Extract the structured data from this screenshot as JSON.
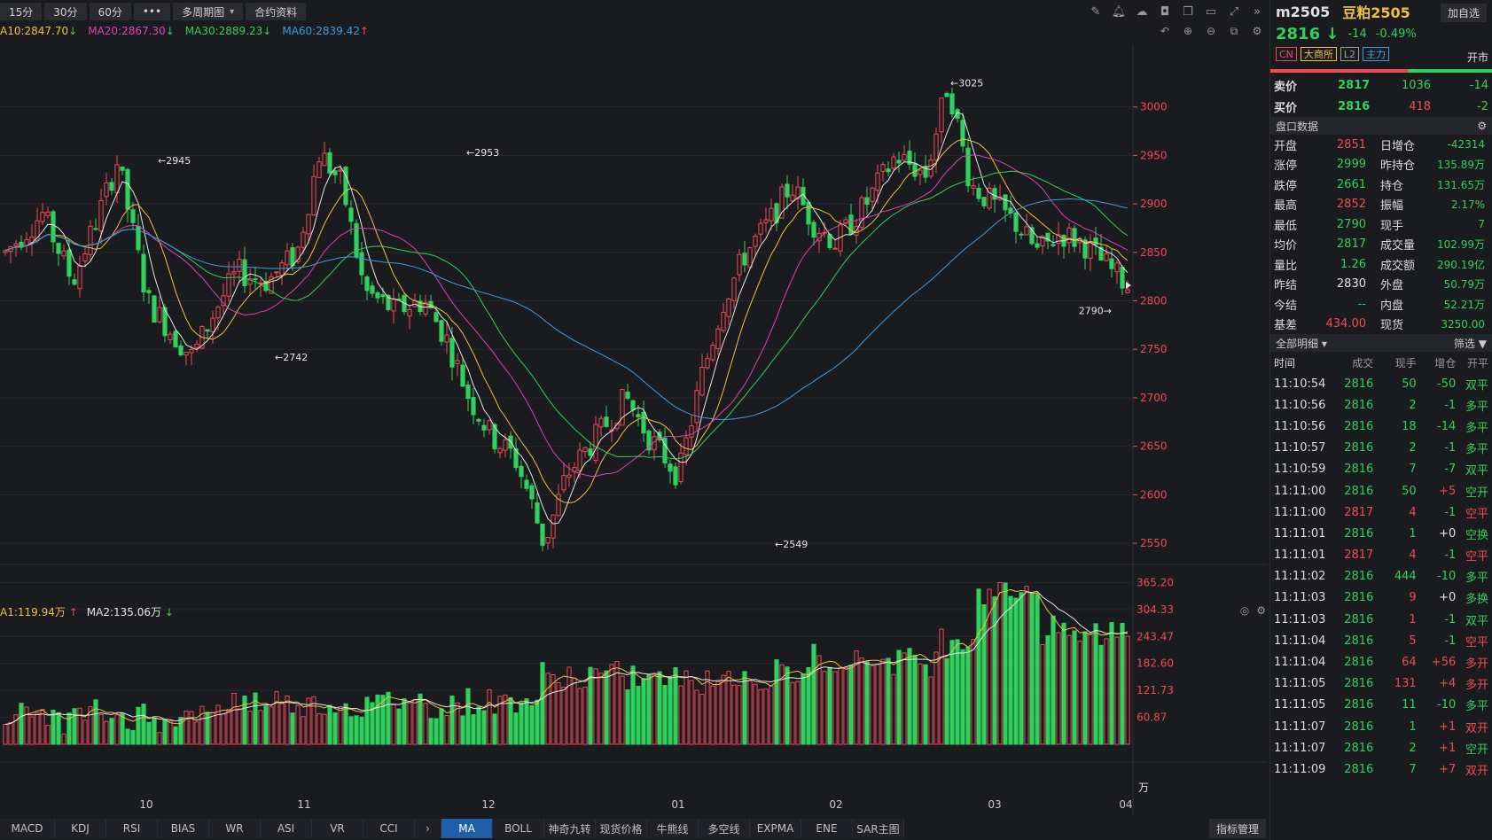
{
  "toolbar": {
    "buttons": [
      "15分",
      "30分",
      "60分",
      "•••",
      "多周期图",
      "合约资料"
    ],
    "icons": [
      "pencil-icon",
      "bell-icon",
      "cloud-icon",
      "camera-icon",
      "copy-icon",
      "monitor-icon",
      "fullscreen-icon",
      "collapse-icon"
    ]
  },
  "ma_legend": [
    {
      "text": "A10:2847.70",
      "color": "#f0c040",
      "arrow": "↓",
      "arrow_color": "#2fd15c"
    },
    {
      "text": "MA20:2867.30",
      "color": "#e040b0",
      "arrow": "↓",
      "arrow_color": "#2fd15c"
    },
    {
      "text": "MA30:2889.23",
      "color": "#2fd15c",
      "arrow": "↓",
      "arrow_color": "#2fd15c"
    },
    {
      "text": "MA60:2839.42",
      "color": "#3a9ee0",
      "arrow": "↑",
      "arrow_color": "#f24957"
    }
  ],
  "vol_legend": [
    {
      "text": "A1:119.94万",
      "color": "#f0c040",
      "arrow": "↑",
      "arrow_color": "#f24957"
    },
    {
      "text": "MA2:135.06万",
      "color": "#e6e6e6",
      "arrow": "↓",
      "arrow_color": "#2fd15c"
    }
  ],
  "chart_data": {
    "type": "candlestick",
    "price_axis": {
      "ticks": [
        3000,
        2950,
        2900,
        2850,
        2800,
        2750,
        2700,
        2650,
        2600,
        2550
      ],
      "range": [
        2530,
        3060
      ]
    },
    "volume_axis": {
      "ticks": [
        "365.20",
        "304.33",
        "243.47",
        "182.60",
        "121.73",
        "60.87"
      ],
      "unit": "万",
      "range": [
        0,
        380
      ]
    },
    "x_labels": [
      "10",
      "11",
      "12",
      "01",
      "02",
      "03",
      "04"
    ],
    "annotations": [
      "2945",
      "2953",
      "2742",
      "2549",
      "3025",
      "2790"
    ],
    "current_marker": "2816"
  },
  "indicator_tabs": [
    "MACD",
    "KDJ",
    "RSI",
    "BIAS",
    "WR",
    "ASI",
    "VR",
    "CCI",
    "›",
    "MA",
    "BOLL",
    "神奇九转",
    "现货价格",
    "牛熊线",
    "多空线",
    "EXPMA",
    "ENE",
    "SAR主图"
  ],
  "active_indicator": "MA",
  "indicator_manage": "指标管理",
  "panel": {
    "code": "m2505",
    "name": "豆粕2505",
    "add_fav": "加自选",
    "price": "2816",
    "change": "-14",
    "change_pct": "-0.49%",
    "tags": [
      "CN",
      "大商所",
      "L2",
      "主力"
    ],
    "open_status": "开市",
    "orderbook": [
      {
        "label": "卖价",
        "price": "2817",
        "vol": "1036",
        "chg": "-14"
      },
      {
        "label": "买价",
        "price": "2816",
        "vol": "418",
        "chg": "-2"
      }
    ],
    "stats_title": "盘口数据",
    "stats": [
      {
        "k1": "开盘",
        "v1": "2851",
        "c1": "red",
        "k2": "日增仓",
        "v2": "-42314",
        "c2": "green"
      },
      {
        "k1": "涨停",
        "v1": "2999",
        "c1": "green",
        "k2": "昨持仓",
        "v2": "135.89万",
        "c2": "green"
      },
      {
        "k1": "跌停",
        "v1": "2661",
        "c1": "green",
        "k2": "持仓",
        "v2": "131.65万",
        "c2": "green"
      },
      {
        "k1": "最高",
        "v1": "2852",
        "c1": "red",
        "k2": "振幅",
        "v2": "2.17%",
        "c2": "green"
      },
      {
        "k1": "最低",
        "v1": "2790",
        "c1": "green",
        "k2": "现手",
        "v2": "7",
        "c2": "green"
      },
      {
        "k1": "均价",
        "v1": "2817",
        "c1": "green",
        "k2": "成交量",
        "v2": "102.99万",
        "c2": "green"
      },
      {
        "k1": "量比",
        "v1": "1.26",
        "c1": "green",
        "k2": "成交额",
        "v2": "290.19亿",
        "c2": "green"
      },
      {
        "k1": "昨结",
        "v1": "2830",
        "c1": "white",
        "k2": "外盘",
        "v2": "50.79万",
        "c2": "green"
      },
      {
        "k1": "今结",
        "v1": "--",
        "c1": "green",
        "k2": "内盘",
        "v2": "52.21万",
        "c2": "green"
      },
      {
        "k1": "基差",
        "v1": "434.00",
        "c1": "red",
        "k2": "现货",
        "v2": "3250.00",
        "c2": "green"
      }
    ],
    "detail_title": "全部明细",
    "filter": "筛选",
    "columns": [
      "时间",
      "成交",
      "现手",
      "增仓",
      "开平"
    ],
    "trades": [
      {
        "t": "11:10:54",
        "p": "2816",
        "h": "50",
        "oi": "-50",
        "type": "双平",
        "hc": "green",
        "oic": "green",
        "tc": "green"
      },
      {
        "t": "11:10:56",
        "p": "2816",
        "h": "2",
        "oi": "-1",
        "type": "多平",
        "hc": "green",
        "oic": "green",
        "tc": "green"
      },
      {
        "t": "11:10:56",
        "p": "2816",
        "h": "18",
        "oi": "-14",
        "type": "多平",
        "hc": "green",
        "oic": "green",
        "tc": "green"
      },
      {
        "t": "11:10:57",
        "p": "2816",
        "h": "2",
        "oi": "-1",
        "type": "多平",
        "hc": "green",
        "oic": "green",
        "tc": "green"
      },
      {
        "t": "11:10:59",
        "p": "2816",
        "h": "7",
        "oi": "-7",
        "type": "双平",
        "hc": "green",
        "oic": "green",
        "tc": "green"
      },
      {
        "t": "11:11:00",
        "p": "2816",
        "h": "50",
        "oi": "+5",
        "type": "空开",
        "hc": "green",
        "oic": "red",
        "tc": "green"
      },
      {
        "t": "11:11:00",
        "p": "2817",
        "h": "4",
        "oi": "-1",
        "type": "空平",
        "hc": "red",
        "oic": "green",
        "tc": "red"
      },
      {
        "t": "11:11:01",
        "p": "2816",
        "h": "1",
        "oi": "+0",
        "type": "空换",
        "hc": "green",
        "oic": "white",
        "tc": "green"
      },
      {
        "t": "11:11:01",
        "p": "2817",
        "h": "4",
        "oi": "-1",
        "type": "空平",
        "hc": "red",
        "oic": "green",
        "tc": "red"
      },
      {
        "t": "11:11:02",
        "p": "2816",
        "h": "444",
        "oi": "-10",
        "type": "多平",
        "hc": "green",
        "oic": "green",
        "tc": "green"
      },
      {
        "t": "11:11:03",
        "p": "2816",
        "h": "9",
        "oi": "+0",
        "type": "多换",
        "hc": "red",
        "oic": "white",
        "tc": "green"
      },
      {
        "t": "11:11:03",
        "p": "2816",
        "h": "1",
        "oi": "-1",
        "type": "双平",
        "hc": "red",
        "oic": "green",
        "tc": "green"
      },
      {
        "t": "11:11:04",
        "p": "2816",
        "h": "5",
        "oi": "-1",
        "type": "空平",
        "hc": "red",
        "oic": "green",
        "tc": "red"
      },
      {
        "t": "11:11:04",
        "p": "2816",
        "h": "64",
        "oi": "+56",
        "type": "多开",
        "hc": "red",
        "oic": "red",
        "tc": "red"
      },
      {
        "t": "11:11:05",
        "p": "2816",
        "h": "131",
        "oi": "+4",
        "type": "多开",
        "hc": "red",
        "oic": "red",
        "tc": "red"
      },
      {
        "t": "11:11:05",
        "p": "2816",
        "h": "11",
        "oi": "-10",
        "type": "多平",
        "hc": "green",
        "oic": "green",
        "tc": "green"
      },
      {
        "t": "11:11:07",
        "p": "2816",
        "h": "1",
        "oi": "+1",
        "type": "双开",
        "hc": "green",
        "oic": "red",
        "tc": "red"
      },
      {
        "t": "11:11:07",
        "p": "2816",
        "h": "2",
        "oi": "+1",
        "type": "空开",
        "hc": "green",
        "oic": "red",
        "tc": "green"
      },
      {
        "t": "11:11:09",
        "p": "2816",
        "h": "7",
        "oi": "+7",
        "type": "双开",
        "hc": "green",
        "oic": "red",
        "tc": "red"
      }
    ]
  }
}
